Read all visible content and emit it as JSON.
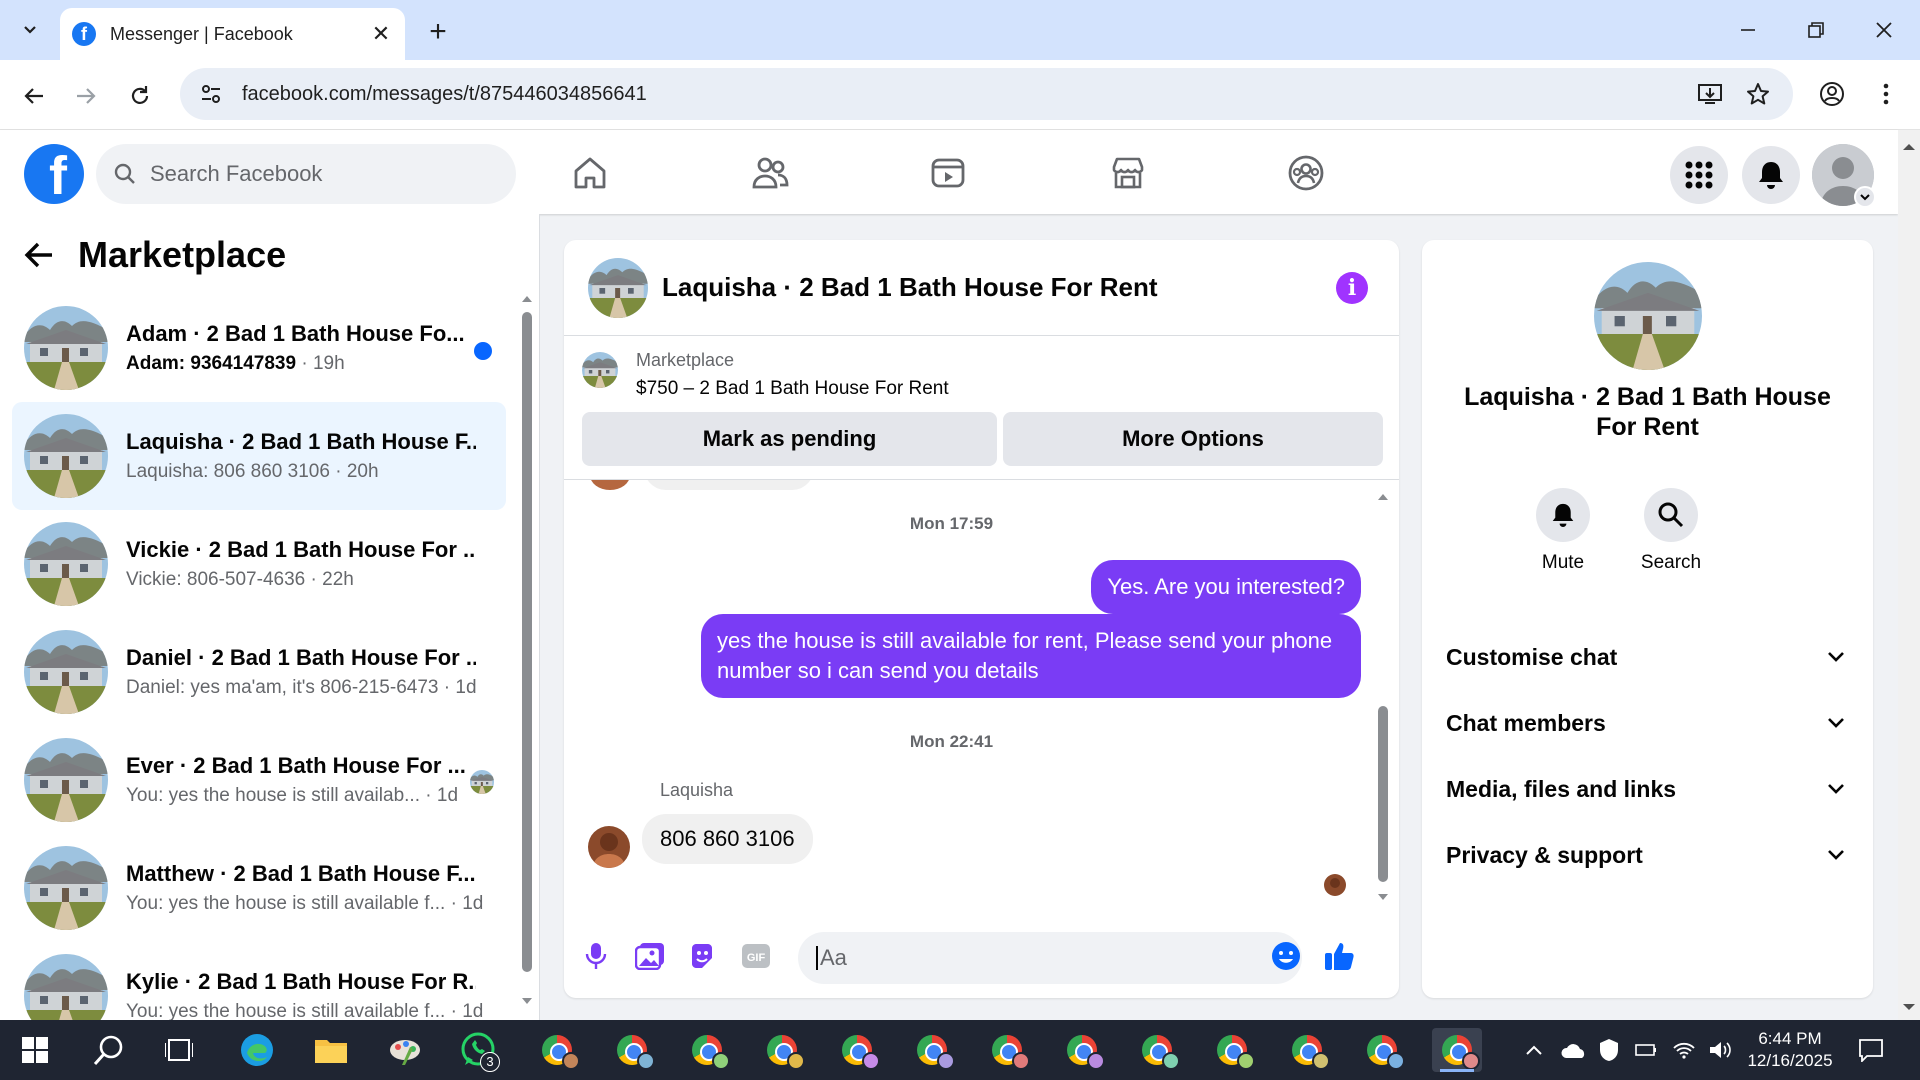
{
  "browser": {
    "tab_title": "Messenger | Facebook",
    "url": "facebook.com/messages/t/875446034856641"
  },
  "fb_header": {
    "search_placeholder": "Search Facebook"
  },
  "left": {
    "title": "Marketplace",
    "conversations": [
      {
        "name": "Adam · 2 Bad 1 Bath House Fo...",
        "snippet": "Adam: 9364147839",
        "time": "19h",
        "unread": true
      },
      {
        "name": "Laquisha · 2 Bad 1 Bath House F...",
        "snippet": "Laquisha: 806 860 3106",
        "time": "20h",
        "active": true
      },
      {
        "name": "Vickie · 2 Bad 1 Bath House For ...",
        "snippet": "Vickie: 806-507-4636",
        "time": "22h"
      },
      {
        "name": "Daniel · 2 Bad 1 Bath House For ...",
        "snippet": "Daniel: yes ma'am, it's 806-215-6473",
        "time": "1d"
      },
      {
        "name": "Ever · 2 Bad 1 Bath House For ...",
        "snippet": "You: yes the house is still availab...",
        "time": "1d"
      },
      {
        "name": "Matthew · 2 Bad 1 Bath House F...",
        "snippet": "You: yes the house is still available f...",
        "time": "1d"
      },
      {
        "name": "Kylie · 2 Bad 1 Bath House For R...",
        "snippet": "You: yes the house is still available f...",
        "time": "1d"
      }
    ]
  },
  "chat": {
    "title": "Laquisha · 2 Bad 1 Bath House For Rent",
    "listing_source": "Marketplace",
    "listing_title": "$750 – 2 Bad 1 Bath House For Rent",
    "btn_pending": "Mark as pending",
    "btn_more": "More Options",
    "timestamp1": "Mon 17:59",
    "msg_out1": "Yes. Are you interested?",
    "msg_out2": "yes the house is still available for rent, Please send your phone number so i can send you details",
    "timestamp2": "Mon 22:41",
    "sender": "Laquisha",
    "msg_in1": "806 860 3106",
    "composer_placeholder": "Aa"
  },
  "info": {
    "name": "Laquisha · 2 Bad 1 Bath House For Rent",
    "mute_label": "Mute",
    "search_label": "Search",
    "rows": [
      "Customise chat",
      "Chat members",
      "Media, files and links",
      "Privacy & support"
    ]
  },
  "taskbar": {
    "whatsapp_badge": "3",
    "time": "6:44 PM",
    "date": "12/16/2025"
  },
  "colors": {
    "fb_blue": "#1877f2",
    "outgoing_bubble": "#7a3cf5",
    "info_purple": "#a033ff",
    "active_row": "#ebf5ff"
  }
}
